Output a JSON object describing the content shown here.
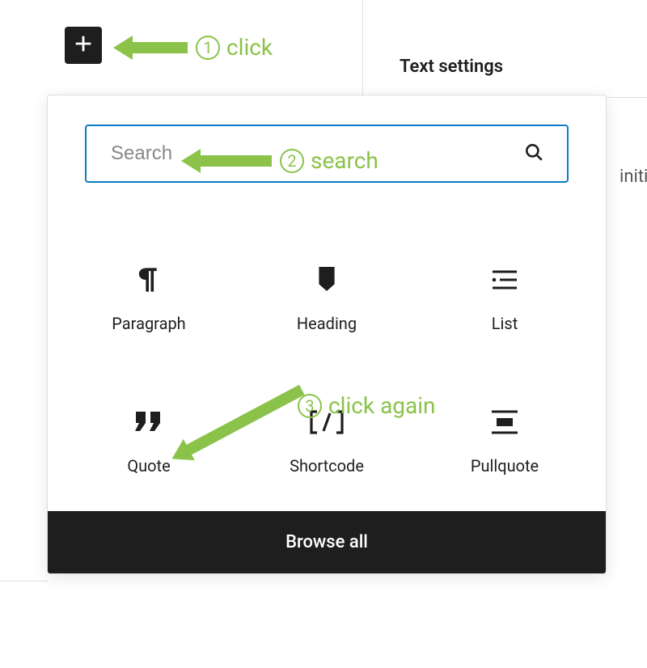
{
  "toolbar": {
    "add_block_label": "Add block"
  },
  "sidebar": {
    "panel_title": "Text settings",
    "extra_text": "initia"
  },
  "inserter": {
    "search_placeholder": "Search",
    "blocks": [
      {
        "id": "paragraph",
        "label": "Paragraph"
      },
      {
        "id": "heading",
        "label": "Heading"
      },
      {
        "id": "list",
        "label": "List"
      },
      {
        "id": "quote",
        "label": "Quote"
      },
      {
        "id": "shortcode",
        "label": "Shortcode"
      },
      {
        "id": "pullquote",
        "label": "Pullquote"
      }
    ],
    "browse_all_label": "Browse all"
  },
  "annotations": [
    {
      "step": "1",
      "text": "click"
    },
    {
      "step": "2",
      "text": "search"
    },
    {
      "step": "3",
      "text": "click again"
    }
  ]
}
